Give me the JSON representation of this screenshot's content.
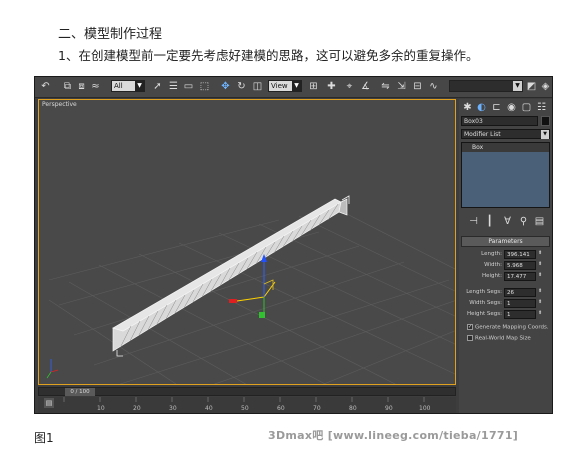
{
  "article": {
    "heading": "二、模型制作过程",
    "subheading": "1、在创建模型前一定要先考虑好建模的思路，这可以避免多余的重复操作。",
    "caption": "图1",
    "watermark": "3Dmax吧 [www.lineeg.com/tieba/1771]"
  },
  "toolbar": {
    "selection_filter": "All",
    "ref_coord": "View",
    "named_selection": ""
  },
  "viewport": {
    "label": "Perspective",
    "active_border_color": "#e0a020"
  },
  "command_panel": {
    "object_name": "Box03",
    "modifier_list_label": "Modifier List",
    "stack_item": "Box",
    "rollout_title": "Parameters",
    "params": [
      {
        "label": "Length:",
        "value": "396.141"
      },
      {
        "label": "Width:",
        "value": "5.968"
      },
      {
        "label": "Height:",
        "value": "17.477"
      }
    ],
    "segs": [
      {
        "label": "Length Segs:",
        "value": "26"
      },
      {
        "label": "Width Segs:",
        "value": "1"
      },
      {
        "label": "Height Segs:",
        "value": "1"
      }
    ],
    "gen_mapping_label": "Generate Mapping Coords.",
    "real_world_label": "Real-World Map Size"
  },
  "timeline": {
    "frame_display": "0 / 100",
    "ticks": [
      "10",
      "20",
      "30",
      "40",
      "50",
      "60",
      "70",
      "80",
      "90",
      "100"
    ]
  }
}
